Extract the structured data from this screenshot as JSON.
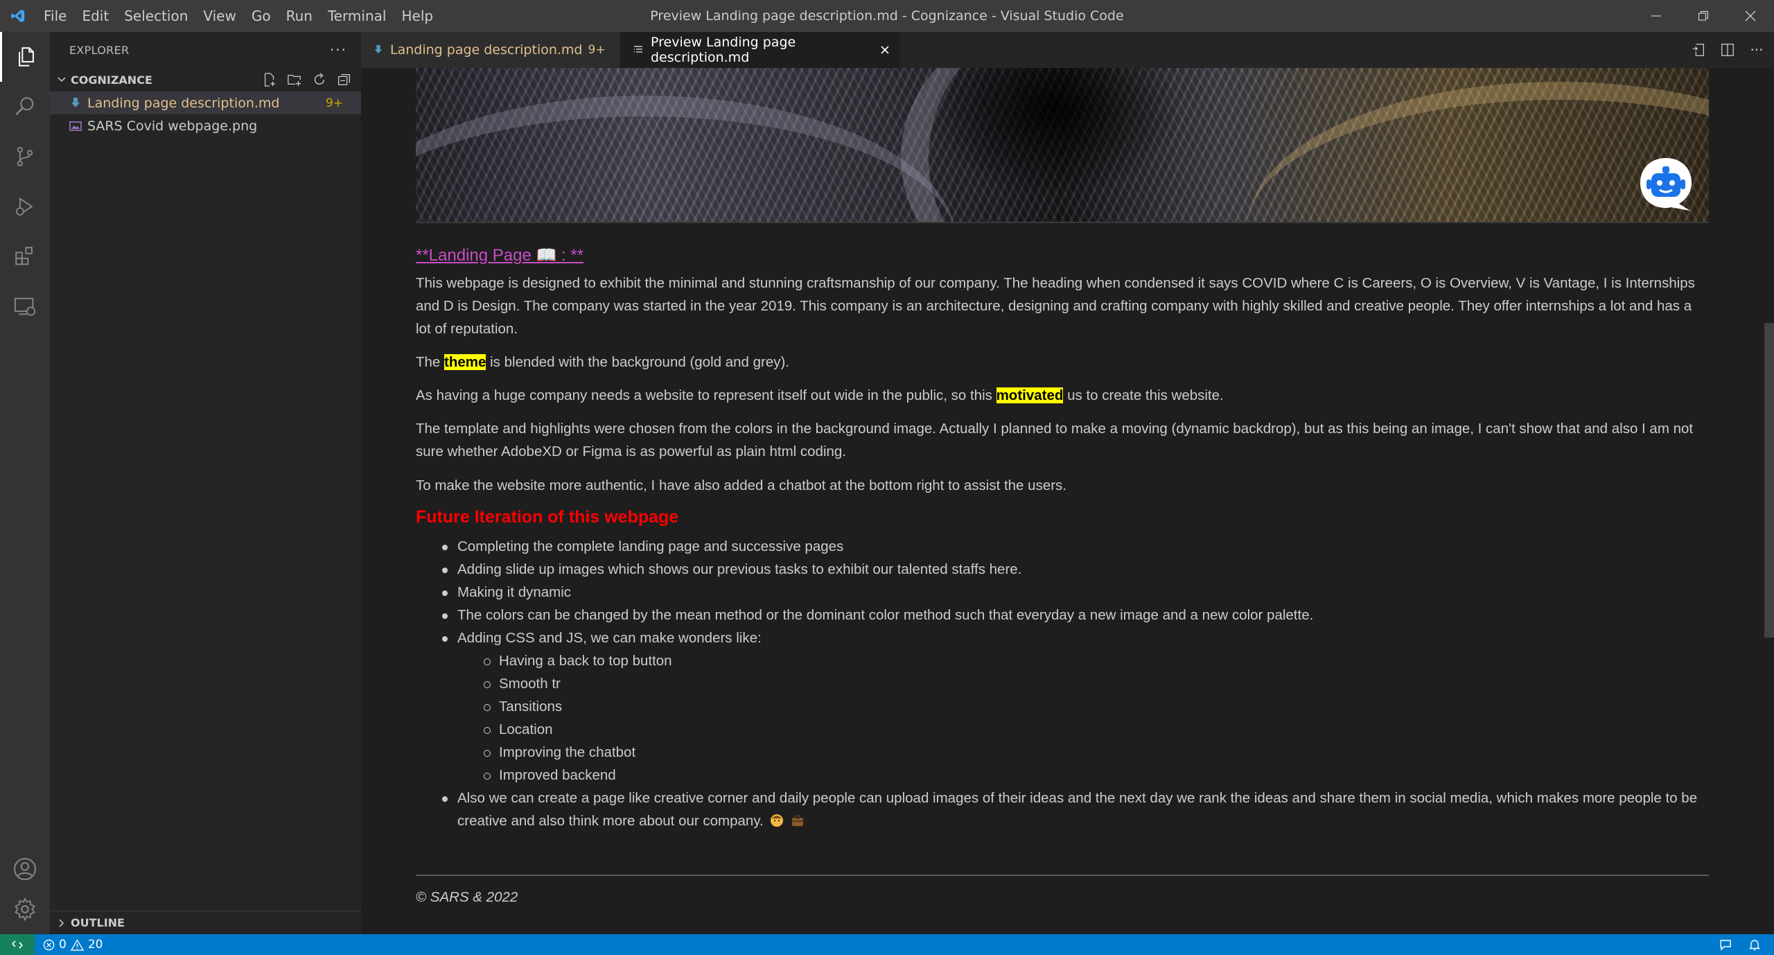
{
  "window": {
    "title": "Preview Landing page description.md - Cognizance - Visual Studio Code"
  },
  "menu": [
    "File",
    "Edit",
    "Selection",
    "View",
    "Go",
    "Run",
    "Terminal",
    "Help"
  ],
  "sidebar": {
    "title": "EXPLORER",
    "more": "···",
    "folder": "COGNIZANCE",
    "files": [
      {
        "name": "Landing page description.md",
        "badge": "9+",
        "icon": "markdown-file-icon"
      },
      {
        "name": "SARS Covid webpage.png",
        "icon": "image-file-icon"
      }
    ],
    "outline": "OUTLINE"
  },
  "tabs": [
    {
      "label": "Landing page description.md",
      "badge": "9+"
    },
    {
      "label": "Preview Landing page description.md"
    }
  ],
  "preview": {
    "title": "**Landing Page  📖  : **",
    "p1": "This webpage is designed to exhibit the minimal and stunning craftsmanship of our company. The heading when condensed it says COVID where C is Careers, O is Overview, V is Vantage, I is Internships and D is Design. The company was started in the year 2019. This company is an architecture, designing and crafting company with highly skilled and creative people. They offer internships a lot and has a lot of reputation.",
    "p2_before": "The ",
    "p2_hl": "theme",
    "p2_after": " is blended with the background (gold and grey).",
    "p3_before": "As having a huge company needs a website to represent itself out wide in the public, so this ",
    "p3_hl": "motivated",
    "p3_after": " us to create this website.",
    "p4": "The template and highlights were chosen from the colors in the background image. Actually I planned to make a moving (dynamic backdrop), but as this being an image, I can't show that and also I am not sure whether AdobeXD or Figma is as powerful as plain html coding.",
    "p5": "To make the website more authentic, I have also added a chatbot at the bottom right to assist the users.",
    "h3": "Future Iteration of this webpage",
    "list": [
      "Completing the complete landing page and successive pages",
      "Adding slide up images which shows our previous tasks to exhibit our talented staffs here.",
      "Making it dynamic",
      "The colors can be changed by the mean method or the dominant color method such that everyday a new image and a new color palette.",
      "Adding CSS and JS, we can make wonders like:"
    ],
    "sublist": [
      "Having a back to top button",
      "Smooth tr",
      "Tansitions",
      "Location",
      "Improving the chatbot",
      "Improved backend"
    ],
    "last_item": "Also we can create a page like creative corner and daily people can upload images of their ideas and the next day we rank the ideas and share them in social media, which makes more people to be creative and also think more about our company.",
    "footer": "© SARS & 2022"
  },
  "status": {
    "errors": "0",
    "warnings": "20"
  },
  "colors": {
    "accent": "#007acc",
    "title_link": "#c74ec6",
    "heading_red": "#ff0000",
    "highlight": "#ffff00",
    "modified_file": "#e2c08d"
  }
}
